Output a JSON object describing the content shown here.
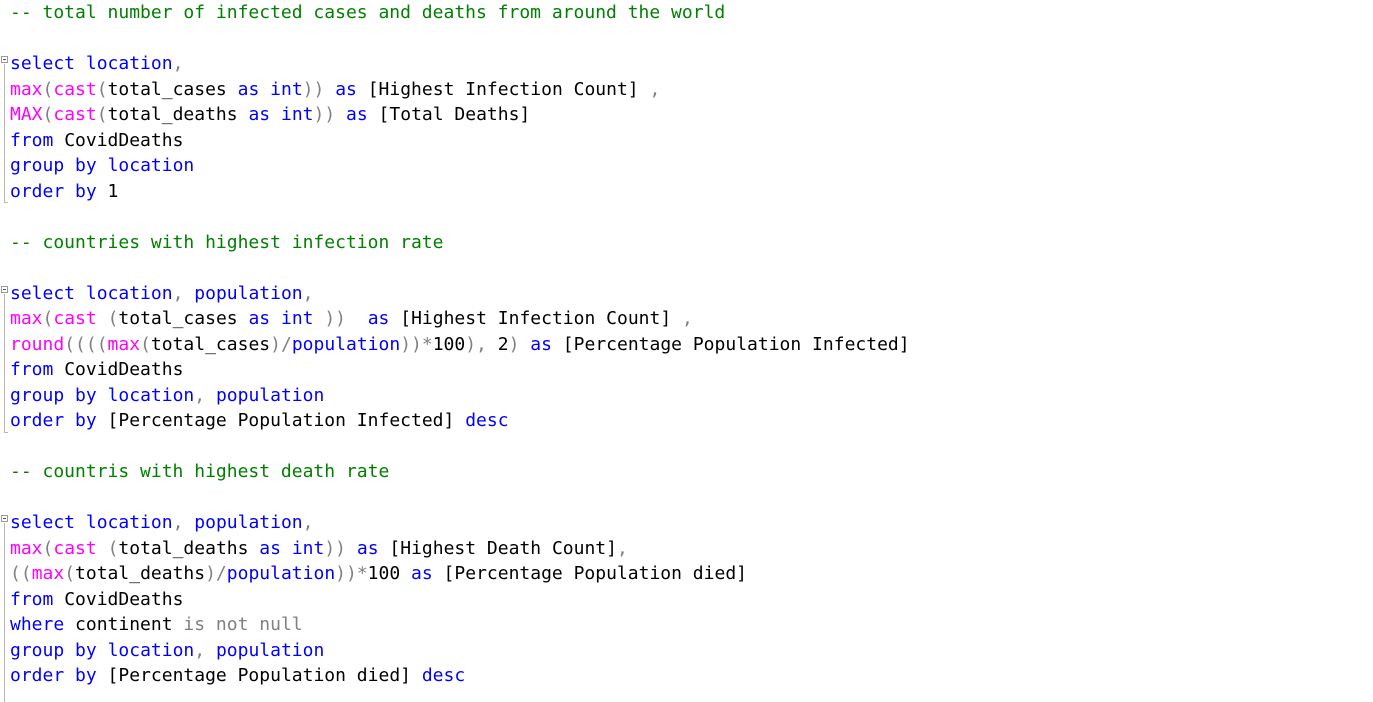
{
  "editor": {
    "colors": {
      "keyword": "#0000ff",
      "function": "#ff00ff",
      "operator": "#808080",
      "comment": "#008000",
      "text": "#000000"
    },
    "lines": [
      [
        {
          "t": "cm",
          "v": "-- total number of infected cases and deaths from around the world"
        }
      ],
      [],
      [
        {
          "t": "kw",
          "v": "select"
        },
        {
          "t": "tx",
          "v": " "
        },
        {
          "t": "kw",
          "v": "location"
        },
        {
          "t": "op",
          "v": ","
        }
      ],
      [
        {
          "t": "fn",
          "v": "max"
        },
        {
          "t": "op",
          "v": "("
        },
        {
          "t": "fn",
          "v": "cast"
        },
        {
          "t": "op",
          "v": "("
        },
        {
          "t": "tx",
          "v": "total_cases "
        },
        {
          "t": "kw",
          "v": "as"
        },
        {
          "t": "tx",
          "v": " "
        },
        {
          "t": "kw",
          "v": "int"
        },
        {
          "t": "op",
          "v": "))"
        },
        {
          "t": "tx",
          "v": " "
        },
        {
          "t": "kw",
          "v": "as"
        },
        {
          "t": "tx",
          "v": " [Highest Infection Count] "
        },
        {
          "t": "op",
          "v": ","
        }
      ],
      [
        {
          "t": "fn",
          "v": "MAX"
        },
        {
          "t": "op",
          "v": "("
        },
        {
          "t": "fn",
          "v": "cast"
        },
        {
          "t": "op",
          "v": "("
        },
        {
          "t": "tx",
          "v": "total_deaths "
        },
        {
          "t": "kw",
          "v": "as"
        },
        {
          "t": "tx",
          "v": " "
        },
        {
          "t": "kw",
          "v": "int"
        },
        {
          "t": "op",
          "v": "))"
        },
        {
          "t": "tx",
          "v": " "
        },
        {
          "t": "kw",
          "v": "as"
        },
        {
          "t": "tx",
          "v": " [Total Deaths]"
        }
      ],
      [
        {
          "t": "kw",
          "v": "from"
        },
        {
          "t": "tx",
          "v": " CovidDeaths"
        }
      ],
      [
        {
          "t": "kw",
          "v": "group"
        },
        {
          "t": "tx",
          "v": " "
        },
        {
          "t": "kw",
          "v": "by"
        },
        {
          "t": "tx",
          "v": " "
        },
        {
          "t": "kw",
          "v": "location"
        }
      ],
      [
        {
          "t": "kw",
          "v": "order"
        },
        {
          "t": "tx",
          "v": " "
        },
        {
          "t": "kw",
          "v": "by"
        },
        {
          "t": "tx",
          "v": " 1"
        }
      ],
      [],
      [
        {
          "t": "cm",
          "v": "-- countries with highest infection rate"
        }
      ],
      [],
      [
        {
          "t": "kw",
          "v": "select"
        },
        {
          "t": "tx",
          "v": " "
        },
        {
          "t": "kw",
          "v": "location"
        },
        {
          "t": "op",
          "v": ","
        },
        {
          "t": "tx",
          "v": " "
        },
        {
          "t": "kw",
          "v": "population"
        },
        {
          "t": "op",
          "v": ","
        }
      ],
      [
        {
          "t": "fn",
          "v": "max"
        },
        {
          "t": "op",
          "v": "("
        },
        {
          "t": "fn",
          "v": "cast"
        },
        {
          "t": "tx",
          "v": " "
        },
        {
          "t": "op",
          "v": "("
        },
        {
          "t": "tx",
          "v": "total_cases "
        },
        {
          "t": "kw",
          "v": "as"
        },
        {
          "t": "tx",
          "v": " "
        },
        {
          "t": "kw",
          "v": "int"
        },
        {
          "t": "tx",
          "v": " "
        },
        {
          "t": "op",
          "v": "))"
        },
        {
          "t": "tx",
          "v": "  "
        },
        {
          "t": "kw",
          "v": "as"
        },
        {
          "t": "tx",
          "v": " [Highest Infection Count] "
        },
        {
          "t": "op",
          "v": ","
        }
      ],
      [
        {
          "t": "fn",
          "v": "round"
        },
        {
          "t": "op",
          "v": "((("
        },
        {
          "t": "op",
          "v": "("
        },
        {
          "t": "fn",
          "v": "max"
        },
        {
          "t": "op",
          "v": "("
        },
        {
          "t": "tx",
          "v": "total_cases"
        },
        {
          "t": "op",
          "v": ")/"
        },
        {
          "t": "kw",
          "v": "population"
        },
        {
          "t": "op",
          "v": "))*"
        },
        {
          "t": "tx",
          "v": "100"
        },
        {
          "t": "op",
          "v": "),"
        },
        {
          "t": "tx",
          "v": " 2"
        },
        {
          "t": "op",
          "v": ")"
        },
        {
          "t": "tx",
          "v": " "
        },
        {
          "t": "kw",
          "v": "as"
        },
        {
          "t": "tx",
          "v": " [Percentage Population Infected]"
        }
      ],
      [
        {
          "t": "kw",
          "v": "from"
        },
        {
          "t": "tx",
          "v": " CovidDeaths"
        }
      ],
      [
        {
          "t": "kw",
          "v": "group"
        },
        {
          "t": "tx",
          "v": " "
        },
        {
          "t": "kw",
          "v": "by"
        },
        {
          "t": "tx",
          "v": " "
        },
        {
          "t": "kw",
          "v": "location"
        },
        {
          "t": "op",
          "v": ","
        },
        {
          "t": "tx",
          "v": " "
        },
        {
          "t": "kw",
          "v": "population"
        }
      ],
      [
        {
          "t": "kw",
          "v": "order"
        },
        {
          "t": "tx",
          "v": " "
        },
        {
          "t": "kw",
          "v": "by"
        },
        {
          "t": "tx",
          "v": " [Percentage Population Infected] "
        },
        {
          "t": "kw",
          "v": "desc"
        }
      ],
      [],
      [
        {
          "t": "cm",
          "v": "-- countris with highest death rate"
        }
      ],
      [],
      [
        {
          "t": "kw",
          "v": "select"
        },
        {
          "t": "tx",
          "v": " "
        },
        {
          "t": "kw",
          "v": "location"
        },
        {
          "t": "op",
          "v": ","
        },
        {
          "t": "tx",
          "v": " "
        },
        {
          "t": "kw",
          "v": "population"
        },
        {
          "t": "op",
          "v": ","
        }
      ],
      [
        {
          "t": "fn",
          "v": "max"
        },
        {
          "t": "op",
          "v": "("
        },
        {
          "t": "fn",
          "v": "cast"
        },
        {
          "t": "tx",
          "v": " "
        },
        {
          "t": "op",
          "v": "("
        },
        {
          "t": "tx",
          "v": "total_deaths "
        },
        {
          "t": "kw",
          "v": "as"
        },
        {
          "t": "tx",
          "v": " "
        },
        {
          "t": "kw",
          "v": "int"
        },
        {
          "t": "op",
          "v": "))"
        },
        {
          "t": "tx",
          "v": " "
        },
        {
          "t": "kw",
          "v": "as"
        },
        {
          "t": "tx",
          "v": " [Highest Death Count]"
        },
        {
          "t": "op",
          "v": ","
        }
      ],
      [
        {
          "t": "op",
          "v": "(("
        },
        {
          "t": "fn",
          "v": "max"
        },
        {
          "t": "op",
          "v": "("
        },
        {
          "t": "tx",
          "v": "total_deaths"
        },
        {
          "t": "op",
          "v": ")/"
        },
        {
          "t": "kw",
          "v": "population"
        },
        {
          "t": "op",
          "v": "))*"
        },
        {
          "t": "tx",
          "v": "100 "
        },
        {
          "t": "kw",
          "v": "as"
        },
        {
          "t": "tx",
          "v": " [Percentage Population died]"
        }
      ],
      [
        {
          "t": "kw",
          "v": "from"
        },
        {
          "t": "tx",
          "v": " CovidDeaths"
        }
      ],
      [
        {
          "t": "kw",
          "v": "where"
        },
        {
          "t": "tx",
          "v": " continent "
        },
        {
          "t": "op",
          "v": "is not null"
        }
      ],
      [
        {
          "t": "kw",
          "v": "group"
        },
        {
          "t": "tx",
          "v": " "
        },
        {
          "t": "kw",
          "v": "by"
        },
        {
          "t": "tx",
          "v": " "
        },
        {
          "t": "kw",
          "v": "location"
        },
        {
          "t": "op",
          "v": ","
        },
        {
          "t": "tx",
          "v": " "
        },
        {
          "t": "kw",
          "v": "population"
        }
      ],
      [
        {
          "t": "kw",
          "v": "order"
        },
        {
          "t": "tx",
          "v": " "
        },
        {
          "t": "kw",
          "v": "by"
        },
        {
          "t": "tx",
          "v": " [Percentage Population died] "
        },
        {
          "t": "kw",
          "v": "desc"
        }
      ]
    ]
  }
}
